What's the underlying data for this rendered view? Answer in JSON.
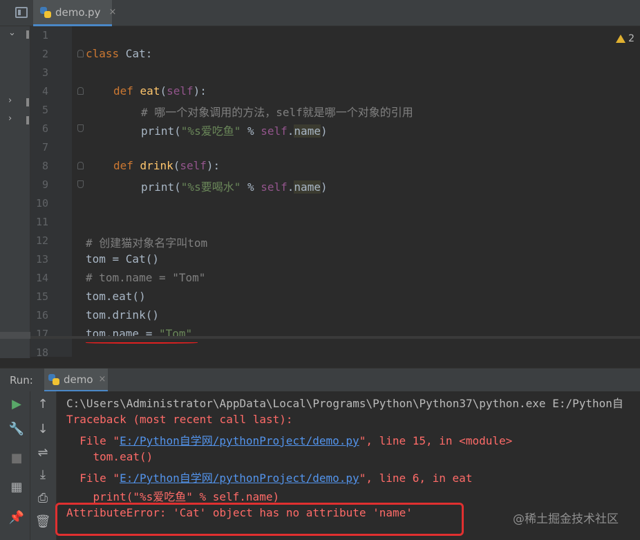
{
  "editor_tab": {
    "label": "demo.py",
    "close": "×"
  },
  "warnings": {
    "count": "2"
  },
  "code_lines": [
    "1",
    "2",
    "3",
    "4",
    "5",
    "6",
    "7",
    "8",
    "9",
    "10",
    "11",
    "12",
    "13",
    "14",
    "15",
    "16",
    "17",
    "18"
  ],
  "code": {
    "l2_kw": "class",
    "l2_rest": " Cat:",
    "l4_kw": "def",
    "l4_fn": "eat",
    "l4_p1": "(",
    "l4_self": "self",
    "l4_p2": "):",
    "l5": "# 哪一个对象调用的方法，self就是哪一个对象的引用",
    "l6_print": "print(",
    "l6_str": "\"%s爱吃鱼\"",
    "l6_op": " % ",
    "l6_self": "self",
    "l6_dot": ".",
    "l6_name": "name",
    "l6_end": ")",
    "l8_kw": "def",
    "l8_fn": "drink",
    "l8_p1": "(",
    "l8_self": "self",
    "l8_p2": "):",
    "l9_print": "print(",
    "l9_str": "\"%s要喝水\"",
    "l9_op": " % ",
    "l9_self": "self",
    "l9_dot": ".",
    "l9_name": "name",
    "l9_end": ")",
    "l12": "# 创建猫对象名字叫tom",
    "l13": "tom = Cat()",
    "l14": "# tom.name = \"Tom\"",
    "l15": "tom.eat()",
    "l16": "tom.drink()",
    "l17_a": "tom.name = ",
    "l17_str": "\"Tom\""
  },
  "run_panel": {
    "label": "Run:",
    "tab_label": "demo",
    "close": "×"
  },
  "console": {
    "cmd": "C:\\Users\\Administrator\\AppData\\Local\\Programs\\Python\\Python37\\python.exe E:/Python自",
    "traceback": "Traceback (most recent call last):",
    "file1_pre": "  File \"",
    "file1_link": "E:/Python自学网/pythonProject/demo.py",
    "file1_post": "\", line 15, in <module>",
    "code1": "    tom.eat()",
    "file2_pre": "  File \"",
    "file2_link": "E:/Python自学网/pythonProject/demo.py",
    "file2_post": "\", line 6, in eat",
    "code2": "    print(\"%s爱吃鱼\" % self.name)",
    "error": "AttributeError: 'Cat' object has no attribute 'name'"
  },
  "watermark": "@稀土掘金技术社区",
  "colors": {
    "keyword": "#cc7832",
    "string": "#6a8759",
    "error": "#ff6b68",
    "link": "#5394ec",
    "annotation": "#e03030"
  }
}
